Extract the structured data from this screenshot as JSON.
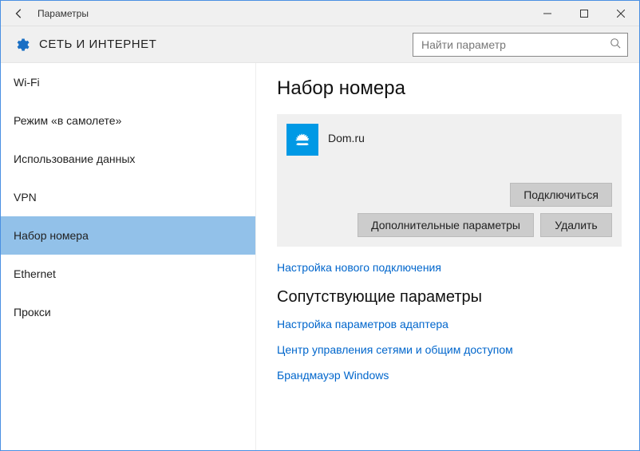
{
  "window": {
    "title": "Параметры"
  },
  "header": {
    "section": "СЕТЬ И ИНТЕРНЕТ",
    "search_placeholder": "Найти параметр"
  },
  "sidebar": {
    "items": [
      {
        "label": "Wi-Fi"
      },
      {
        "label": "Режим «в самолете»"
      },
      {
        "label": "Использование данных"
      },
      {
        "label": "VPN"
      },
      {
        "label": "Набор номера",
        "selected": true
      },
      {
        "label": "Ethernet"
      },
      {
        "label": "Прокси"
      }
    ]
  },
  "main": {
    "title": "Набор номера",
    "connection": {
      "name": "Dom.ru",
      "icon": "dialup-icon",
      "actions": {
        "connect": "Подключиться",
        "advanced": "Дополнительные параметры",
        "delete": "Удалить"
      }
    },
    "new_conn_link": "Настройка нового подключения",
    "related": {
      "title": "Сопутствующие параметры",
      "links": [
        "Настройка параметров адаптера",
        "Центр управления сетями и общим доступом",
        "Брандмауэр Windows"
      ]
    }
  }
}
